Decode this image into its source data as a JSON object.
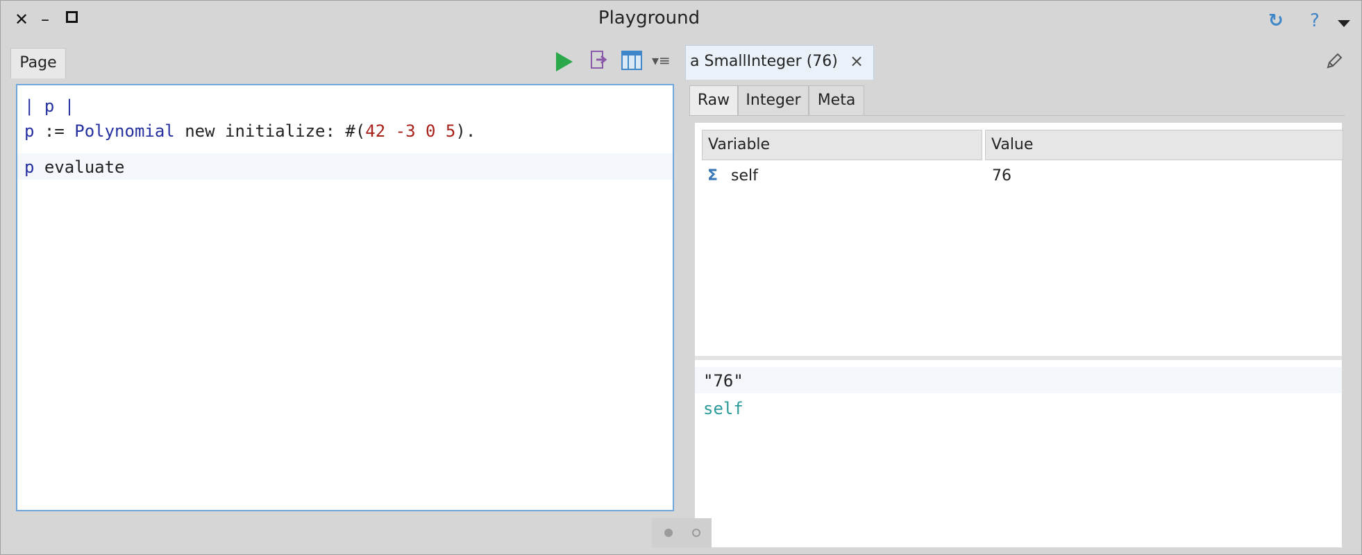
{
  "window": {
    "title": "Playground"
  },
  "titlebar": {
    "close_glyph": "✕",
    "minimize_glyph": "–",
    "help_glyph": "?",
    "sync_glyph": "↻"
  },
  "left": {
    "tab_label": "Page",
    "bindings_glyph": "▾≡",
    "code": {
      "line1": "| p |",
      "line2_var": "p",
      "line2_assign": " := ",
      "line2_class": "Polynomial",
      "line2_msg": " new initialize: #(",
      "line2_n1": "42",
      "line2_n2": " -3",
      "line2_n3": " 0",
      "line2_n4": " 5",
      "line2_end": ").",
      "line3_var": "p",
      "line3_msg": " evaluate"
    }
  },
  "inspector": {
    "tab_label": "a SmallInteger (76)",
    "tab_close": "×",
    "subtabs": [
      "Raw",
      "Integer",
      "Meta"
    ],
    "columns": [
      "Variable",
      "Value"
    ],
    "rows": [
      {
        "icon": "Σ",
        "variable": "self",
        "value": "76"
      }
    ],
    "eval": {
      "line1": "\"76\"",
      "line2": "self"
    }
  },
  "colors": {
    "accent": "#3f86c9",
    "run_green": "#2aa84a",
    "number_red": "#a8201a",
    "keyword_blue": "#2530a0",
    "self_teal": "#2a9a9a"
  },
  "pager": {
    "pages": 2,
    "current": 1
  }
}
